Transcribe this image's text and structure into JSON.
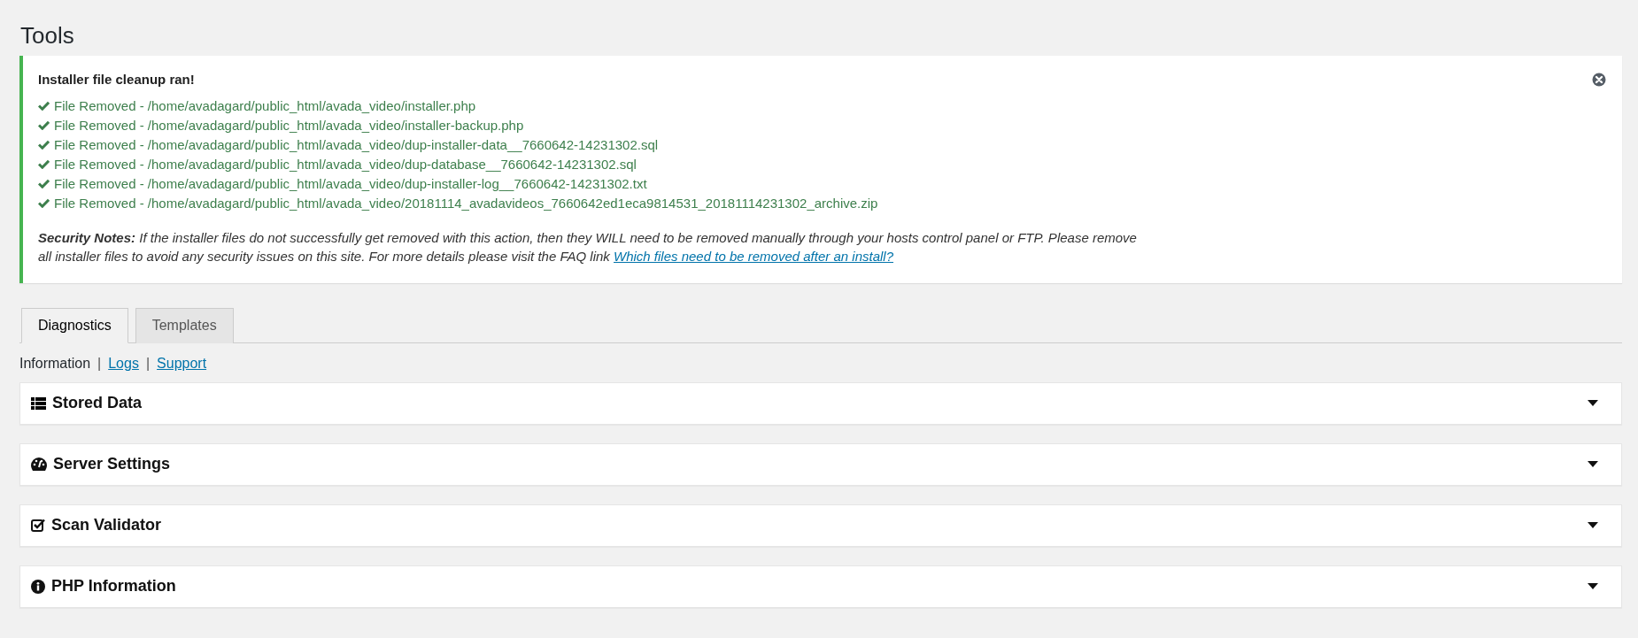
{
  "page_title": "Tools",
  "notice": {
    "title": "Installer file cleanup ran!",
    "items": [
      "File Removed - /home/avadagard/public_html/avada_video/installer.php",
      "File Removed - /home/avadagard/public_html/avada_video/installer-backup.php",
      "File Removed - /home/avadagard/public_html/avada_video/dup-installer-data__7660642-14231302.sql",
      "File Removed - /home/avadagard/public_html/avada_video/dup-database__7660642-14231302.sql",
      "File Removed - /home/avadagard/public_html/avada_video/dup-installer-log__7660642-14231302.txt",
      "File Removed - /home/avadagard/public_html/avada_video/20181114_avadavideos_7660642ed1eca9814531_20181114231302_archive.zip"
    ],
    "security_note": "**Security Notes:** If the installer files do not successfully get removed with this action, then they WILL need to be removed manually through your hosts control panel or FTP. Please remove all installer files to avoid any security issues on this site. For more details please visit the FAQ link",
    "link": "Which files need to be removed after an install?"
  },
  "tabs": [
    {
      "label": "Diagnostics",
      "selected": true
    },
    {
      "label": "Templates",
      "selected": false
    }
  ],
  "subnav": [
    {
      "label": "Information",
      "selected": true
    },
    {
      "label": "Logs",
      "selected": false
    },
    {
      "label": "Support",
      "selected": false
    }
  ],
  "subnav_separators": [
    "|",
    "|"
  ],
  "panels": [
    {
      "title": "Stored Data",
      "expanded": false
    },
    {
      "title": "Server Settings",
      "expanded": false
    },
    {
      "title": "Scan Validator",
      "expanded": false
    },
    {
      "title": "PHP Information",
      "expanded": false
    }
  ]
}
